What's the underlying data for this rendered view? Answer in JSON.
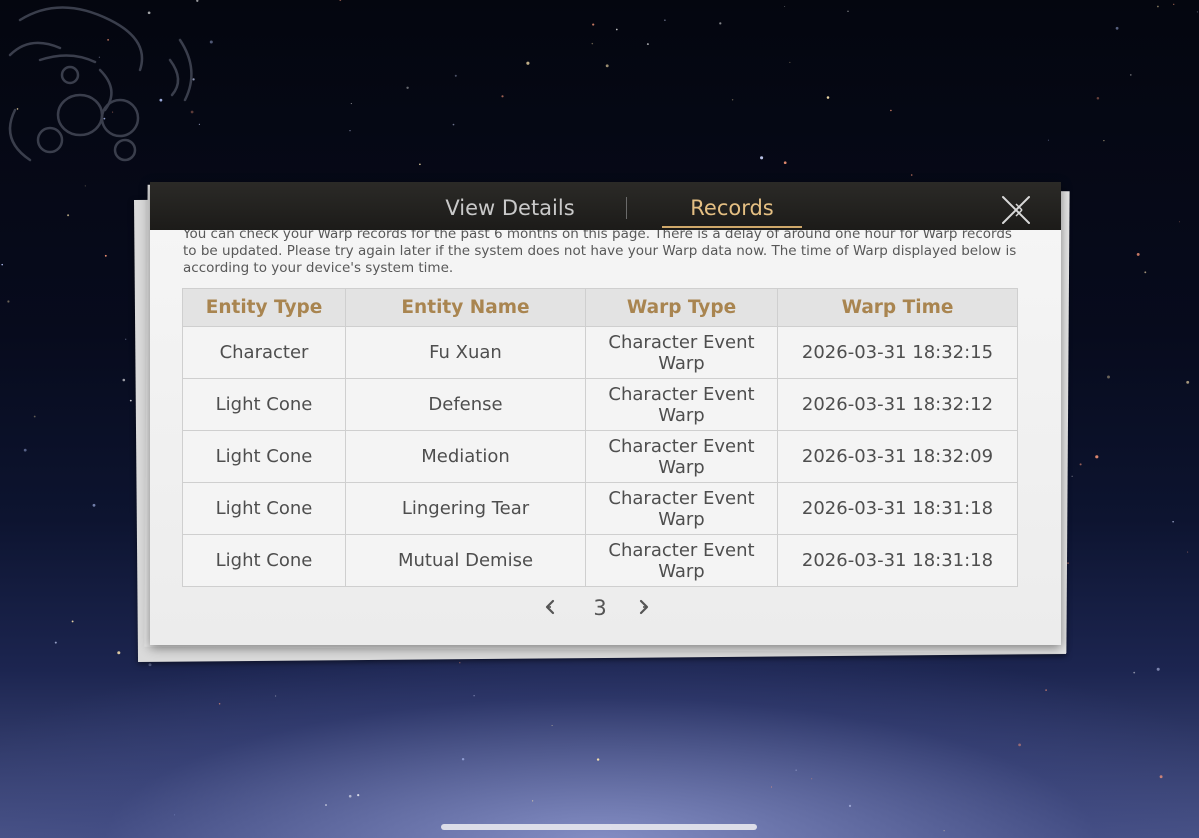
{
  "tabs": {
    "view_details": "View Details",
    "records": "Records"
  },
  "notice": "You can check your Warp records for the past 6 months on this page. There is a delay of around one hour for Warp records to be updated. Please try again later if the system does not have your Warp data now. The time of Warp displayed below is according to your device's system time.",
  "table": {
    "headers": [
      "Entity Type",
      "Entity Name",
      "Warp Type",
      "Warp Time"
    ],
    "rows": [
      {
        "entity_type": "Character",
        "entity_name": "Fu Xuan",
        "warp_type_line1": "Character Event",
        "warp_type_line2": "Warp",
        "warp_time": "2026-03-31 18:32:15"
      },
      {
        "entity_type": "Light Cone",
        "entity_name": "Defense",
        "warp_type_line1": "Character Event",
        "warp_type_line2": "Warp",
        "warp_time": "2026-03-31 18:32:12"
      },
      {
        "entity_type": "Light Cone",
        "entity_name": "Mediation",
        "warp_type_line1": "Character Event",
        "warp_type_line2": "Warp",
        "warp_time": "2026-03-31 18:32:09"
      },
      {
        "entity_type": "Light Cone",
        "entity_name": "Lingering Tear",
        "warp_type_line1": "Character Event",
        "warp_type_line2": "Warp",
        "warp_time": "2026-03-31 18:31:18"
      },
      {
        "entity_type": "Light Cone",
        "entity_name": "Mutual Demise",
        "warp_type_line1": "Character Event",
        "warp_type_line2": "Warp",
        "warp_time": "2026-03-31 18:31:18"
      }
    ]
  },
  "pagination": {
    "current_page": "3"
  },
  "icons": {
    "close": "close-icon",
    "prev": "chevron-left-icon",
    "next": "chevron-right-icon"
  },
  "colors": {
    "accent_gold": "#e4bf83",
    "highlight_name": "#cf9a4b",
    "header_bg": "#1c1b19"
  }
}
